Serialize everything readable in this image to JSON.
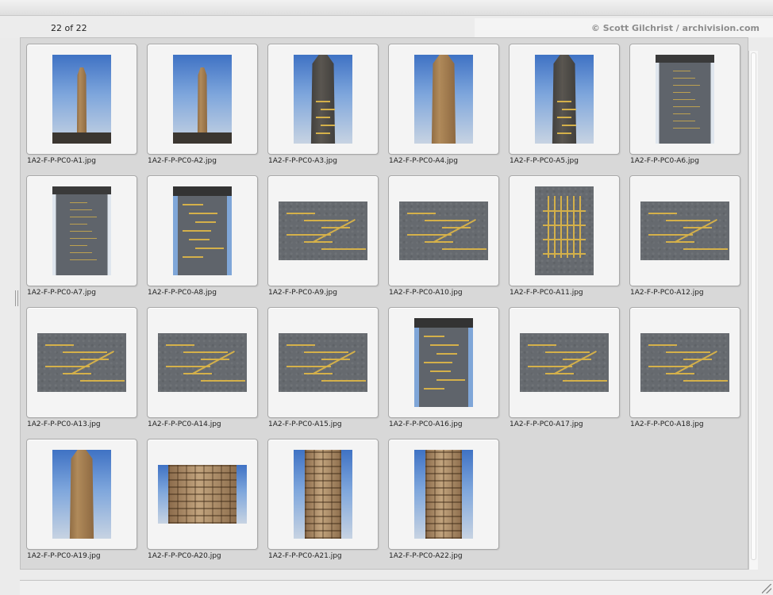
{
  "header": {
    "counter": "22 of 22",
    "credit": "© Scott Gilchrist / archivision.com"
  },
  "thumbnails": [
    {
      "filename": "1A2-F-P-PC0-A1.jpg",
      "style": "obelisk-sky-full"
    },
    {
      "filename": "1A2-F-P-PC0-A2.jpg",
      "style": "obelisk-sky-full"
    },
    {
      "filename": "1A2-F-P-PC0-A3.jpg",
      "style": "pyramidion-dark"
    },
    {
      "filename": "1A2-F-P-PC0-A4.jpg",
      "style": "pyramidion-warm"
    },
    {
      "filename": "1A2-F-P-PC0-A5.jpg",
      "style": "pyramidion-dark"
    },
    {
      "filename": "1A2-F-P-PC0-A6.jpg",
      "style": "pedestal-text"
    },
    {
      "filename": "1A2-F-P-PC0-A7.jpg",
      "style": "pedestal-text"
    },
    {
      "filename": "1A2-F-P-PC0-A8.jpg",
      "style": "pedestal-diagram"
    },
    {
      "filename": "1A2-F-P-PC0-A9.jpg",
      "style": "diagram-landscape"
    },
    {
      "filename": "1A2-F-P-PC0-A10.jpg",
      "style": "diagram-landscape"
    },
    {
      "filename": "1A2-F-P-PC0-A11.jpg",
      "style": "diagram-portrait"
    },
    {
      "filename": "1A2-F-P-PC0-A12.jpg",
      "style": "diagram-landscape"
    },
    {
      "filename": "1A2-F-P-PC0-A13.jpg",
      "style": "diagram-landscape"
    },
    {
      "filename": "1A2-F-P-PC0-A14.jpg",
      "style": "diagram-landscape"
    },
    {
      "filename": "1A2-F-P-PC0-A15.jpg",
      "style": "diagram-landscape"
    },
    {
      "filename": "1A2-F-P-PC0-A16.jpg",
      "style": "pedestal-diagram"
    },
    {
      "filename": "1A2-F-P-PC0-A17.jpg",
      "style": "diagram-landscape"
    },
    {
      "filename": "1A2-F-P-PC0-A18.jpg",
      "style": "diagram-landscape"
    },
    {
      "filename": "1A2-F-P-PC0-A19.jpg",
      "style": "pyramidion-warm"
    },
    {
      "filename": "1A2-F-P-PC0-A20.jpg",
      "style": "hieroglyph-landscape"
    },
    {
      "filename": "1A2-F-P-PC0-A21.jpg",
      "style": "hieroglyph-portrait"
    },
    {
      "filename": "1A2-F-P-PC0-A22.jpg",
      "style": "hieroglyph-portrait"
    }
  ]
}
